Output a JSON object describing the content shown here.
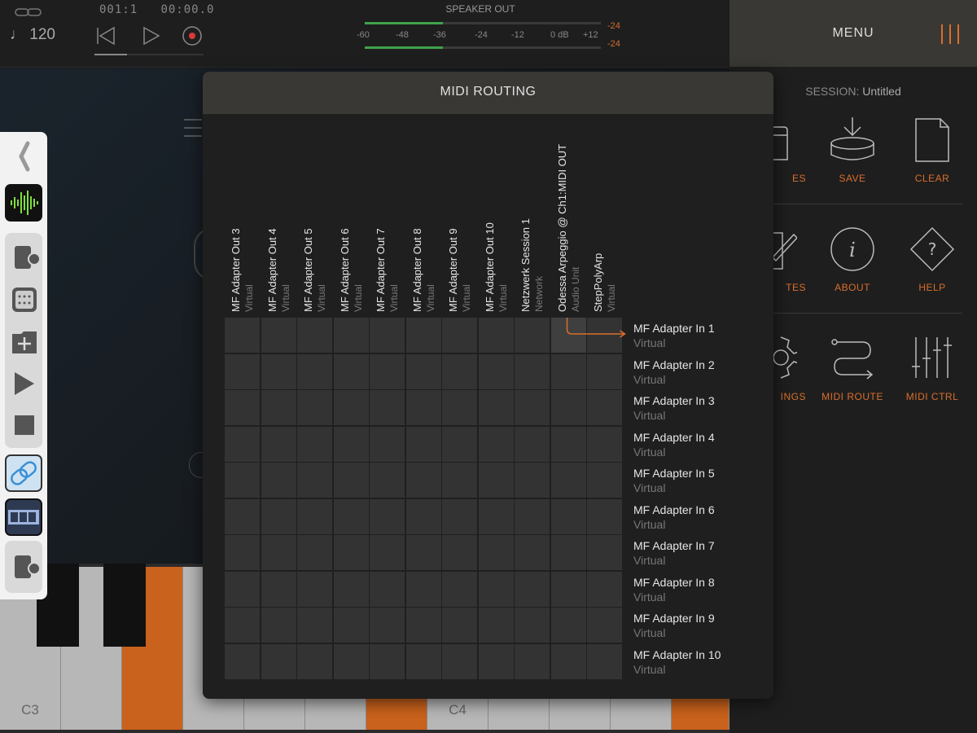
{
  "transport": {
    "tempo": "♩ 120",
    "position": "001:1",
    "time": "00:00.0"
  },
  "meter": {
    "title": "SPEAKER OUT",
    "scale": [
      "-60",
      "-48",
      "-36",
      "-24",
      "-12",
      "0 dB",
      "+12"
    ],
    "peak_top": "-24",
    "peak_bottom": "-24",
    "level_fraction": 0.33
  },
  "keyboard": {
    "label_c3": "C3",
    "label_c4": "C4"
  },
  "menu": {
    "title": "MENU",
    "session_label": "SESSION:",
    "session_name": "Untitled",
    "items": [
      {
        "label": "ES",
        "icon": "folder-icon"
      },
      {
        "label": "SAVE",
        "icon": "save-icon"
      },
      {
        "label": "CLEAR",
        "icon": "clear-icon"
      },
      {
        "label": "TES",
        "icon": "notes-icon"
      },
      {
        "label": "ABOUT",
        "icon": "about-icon"
      },
      {
        "label": "HELP",
        "icon": "help-icon"
      },
      {
        "label": "INGS",
        "icon": "settings-icon"
      },
      {
        "label": "MIDI ROUTE",
        "icon": "midi-route-icon"
      },
      {
        "label": "MIDI CTRL",
        "icon": "midi-ctrl-icon"
      }
    ]
  },
  "modal": {
    "title": "MIDI ROUTING",
    "columns": [
      {
        "name": "MF Adapter Out 3",
        "type": "Virtual"
      },
      {
        "name": "MF Adapter Out 4",
        "type": "Virtual"
      },
      {
        "name": "MF Adapter Out 5",
        "type": "Virtual"
      },
      {
        "name": "MF Adapter Out 6",
        "type": "Virtual"
      },
      {
        "name": "MF Adapter Out 7",
        "type": "Virtual"
      },
      {
        "name": "MF Adapter Out 8",
        "type": "Virtual"
      },
      {
        "name": "MF Adapter Out 9",
        "type": "Virtual"
      },
      {
        "name": "MF Adapter Out 10",
        "type": "Virtual"
      },
      {
        "name": "Netzwerk Session 1",
        "type": "Network"
      },
      {
        "name": "Odessa Arpeggio @ Ch1:MIDI OUT",
        "type": "Audio Unit"
      },
      {
        "name": "StepPolyArp",
        "type": "Virtual"
      }
    ],
    "rows": [
      {
        "name": "MF Adapter In 1",
        "type": "Virtual"
      },
      {
        "name": "MF Adapter In 2",
        "type": "Virtual"
      },
      {
        "name": "MF Adapter In 3",
        "type": "Virtual"
      },
      {
        "name": "MF Adapter In 4",
        "type": "Virtual"
      },
      {
        "name": "MF Adapter In 5",
        "type": "Virtual"
      },
      {
        "name": "MF Adapter In 6",
        "type": "Virtual"
      },
      {
        "name": "MF Adapter In 7",
        "type": "Virtual"
      },
      {
        "name": "MF Adapter In 8",
        "type": "Virtual"
      },
      {
        "name": "MF Adapter In 9",
        "type": "Virtual"
      },
      {
        "name": "MF Adapter In 10",
        "type": "Virtual"
      }
    ],
    "active_connection": {
      "column": 9,
      "row": 0
    }
  },
  "colors": {
    "accent": "#d96f2b",
    "meter_green": "#3fa34a",
    "link_blue": "#3a8fd6"
  }
}
